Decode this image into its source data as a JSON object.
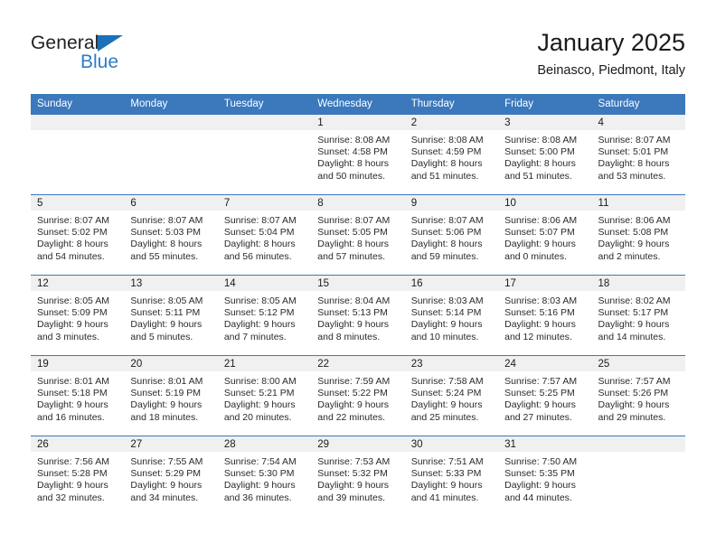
{
  "brand": {
    "name_part1": "General",
    "name_part2": "Blue",
    "triangle_icon": "triangle-icon",
    "accent_color": "#2e7dc4",
    "header_blue": "#3b78bc"
  },
  "header": {
    "title": "January 2025",
    "subtitle": "Beinasco, Piedmont, Italy"
  },
  "weekday_headers": [
    "Sunday",
    "Monday",
    "Tuesday",
    "Wednesday",
    "Thursday",
    "Friday",
    "Saturday"
  ],
  "labels": {
    "sunrise_prefix": "Sunrise:",
    "sunset_prefix": "Sunset:",
    "daylight_prefix": "Daylight:"
  },
  "weeks": [
    [
      {
        "day": "",
        "empty": true
      },
      {
        "day": "",
        "empty": true
      },
      {
        "day": "",
        "empty": true
      },
      {
        "day": "1",
        "sunrise": "Sunrise: 8:08 AM",
        "sunset": "Sunset: 4:58 PM",
        "daylight_line1": "Daylight: 8 hours",
        "daylight_line2": "and 50 minutes."
      },
      {
        "day": "2",
        "sunrise": "Sunrise: 8:08 AM",
        "sunset": "Sunset: 4:59 PM",
        "daylight_line1": "Daylight: 8 hours",
        "daylight_line2": "and 51 minutes."
      },
      {
        "day": "3",
        "sunrise": "Sunrise: 8:08 AM",
        "sunset": "Sunset: 5:00 PM",
        "daylight_line1": "Daylight: 8 hours",
        "daylight_line2": "and 51 minutes."
      },
      {
        "day": "4",
        "sunrise": "Sunrise: 8:07 AM",
        "sunset": "Sunset: 5:01 PM",
        "daylight_line1": "Daylight: 8 hours",
        "daylight_line2": "and 53 minutes."
      }
    ],
    [
      {
        "day": "5",
        "sunrise": "Sunrise: 8:07 AM",
        "sunset": "Sunset: 5:02 PM",
        "daylight_line1": "Daylight: 8 hours",
        "daylight_line2": "and 54 minutes."
      },
      {
        "day": "6",
        "sunrise": "Sunrise: 8:07 AM",
        "sunset": "Sunset: 5:03 PM",
        "daylight_line1": "Daylight: 8 hours",
        "daylight_line2": "and 55 minutes."
      },
      {
        "day": "7",
        "sunrise": "Sunrise: 8:07 AM",
        "sunset": "Sunset: 5:04 PM",
        "daylight_line1": "Daylight: 8 hours",
        "daylight_line2": "and 56 minutes."
      },
      {
        "day": "8",
        "sunrise": "Sunrise: 8:07 AM",
        "sunset": "Sunset: 5:05 PM",
        "daylight_line1": "Daylight: 8 hours",
        "daylight_line2": "and 57 minutes."
      },
      {
        "day": "9",
        "sunrise": "Sunrise: 8:07 AM",
        "sunset": "Sunset: 5:06 PM",
        "daylight_line1": "Daylight: 8 hours",
        "daylight_line2": "and 59 minutes."
      },
      {
        "day": "10",
        "sunrise": "Sunrise: 8:06 AM",
        "sunset": "Sunset: 5:07 PM",
        "daylight_line1": "Daylight: 9 hours",
        "daylight_line2": "and 0 minutes."
      },
      {
        "day": "11",
        "sunrise": "Sunrise: 8:06 AM",
        "sunset": "Sunset: 5:08 PM",
        "daylight_line1": "Daylight: 9 hours",
        "daylight_line2": "and 2 minutes."
      }
    ],
    [
      {
        "day": "12",
        "sunrise": "Sunrise: 8:05 AM",
        "sunset": "Sunset: 5:09 PM",
        "daylight_line1": "Daylight: 9 hours",
        "daylight_line2": "and 3 minutes."
      },
      {
        "day": "13",
        "sunrise": "Sunrise: 8:05 AM",
        "sunset": "Sunset: 5:11 PM",
        "daylight_line1": "Daylight: 9 hours",
        "daylight_line2": "and 5 minutes."
      },
      {
        "day": "14",
        "sunrise": "Sunrise: 8:05 AM",
        "sunset": "Sunset: 5:12 PM",
        "daylight_line1": "Daylight: 9 hours",
        "daylight_line2": "and 7 minutes."
      },
      {
        "day": "15",
        "sunrise": "Sunrise: 8:04 AM",
        "sunset": "Sunset: 5:13 PM",
        "daylight_line1": "Daylight: 9 hours",
        "daylight_line2": "and 8 minutes."
      },
      {
        "day": "16",
        "sunrise": "Sunrise: 8:03 AM",
        "sunset": "Sunset: 5:14 PM",
        "daylight_line1": "Daylight: 9 hours",
        "daylight_line2": "and 10 minutes."
      },
      {
        "day": "17",
        "sunrise": "Sunrise: 8:03 AM",
        "sunset": "Sunset: 5:16 PM",
        "daylight_line1": "Daylight: 9 hours",
        "daylight_line2": "and 12 minutes."
      },
      {
        "day": "18",
        "sunrise": "Sunrise: 8:02 AM",
        "sunset": "Sunset: 5:17 PM",
        "daylight_line1": "Daylight: 9 hours",
        "daylight_line2": "and 14 minutes."
      }
    ],
    [
      {
        "day": "19",
        "sunrise": "Sunrise: 8:01 AM",
        "sunset": "Sunset: 5:18 PM",
        "daylight_line1": "Daylight: 9 hours",
        "daylight_line2": "and 16 minutes."
      },
      {
        "day": "20",
        "sunrise": "Sunrise: 8:01 AM",
        "sunset": "Sunset: 5:19 PM",
        "daylight_line1": "Daylight: 9 hours",
        "daylight_line2": "and 18 minutes."
      },
      {
        "day": "21",
        "sunrise": "Sunrise: 8:00 AM",
        "sunset": "Sunset: 5:21 PM",
        "daylight_line1": "Daylight: 9 hours",
        "daylight_line2": "and 20 minutes."
      },
      {
        "day": "22",
        "sunrise": "Sunrise: 7:59 AM",
        "sunset": "Sunset: 5:22 PM",
        "daylight_line1": "Daylight: 9 hours",
        "daylight_line2": "and 22 minutes."
      },
      {
        "day": "23",
        "sunrise": "Sunrise: 7:58 AM",
        "sunset": "Sunset: 5:24 PM",
        "daylight_line1": "Daylight: 9 hours",
        "daylight_line2": "and 25 minutes."
      },
      {
        "day": "24",
        "sunrise": "Sunrise: 7:57 AM",
        "sunset": "Sunset: 5:25 PM",
        "daylight_line1": "Daylight: 9 hours",
        "daylight_line2": "and 27 minutes."
      },
      {
        "day": "25",
        "sunrise": "Sunrise: 7:57 AM",
        "sunset": "Sunset: 5:26 PM",
        "daylight_line1": "Daylight: 9 hours",
        "daylight_line2": "and 29 minutes."
      }
    ],
    [
      {
        "day": "26",
        "sunrise": "Sunrise: 7:56 AM",
        "sunset": "Sunset: 5:28 PM",
        "daylight_line1": "Daylight: 9 hours",
        "daylight_line2": "and 32 minutes."
      },
      {
        "day": "27",
        "sunrise": "Sunrise: 7:55 AM",
        "sunset": "Sunset: 5:29 PM",
        "daylight_line1": "Daylight: 9 hours",
        "daylight_line2": "and 34 minutes."
      },
      {
        "day": "28",
        "sunrise": "Sunrise: 7:54 AM",
        "sunset": "Sunset: 5:30 PM",
        "daylight_line1": "Daylight: 9 hours",
        "daylight_line2": "and 36 minutes."
      },
      {
        "day": "29",
        "sunrise": "Sunrise: 7:53 AM",
        "sunset": "Sunset: 5:32 PM",
        "daylight_line1": "Daylight: 9 hours",
        "daylight_line2": "and 39 minutes."
      },
      {
        "day": "30",
        "sunrise": "Sunrise: 7:51 AM",
        "sunset": "Sunset: 5:33 PM",
        "daylight_line1": "Daylight: 9 hours",
        "daylight_line2": "and 41 minutes."
      },
      {
        "day": "31",
        "sunrise": "Sunrise: 7:50 AM",
        "sunset": "Sunset: 5:35 PM",
        "daylight_line1": "Daylight: 9 hours",
        "daylight_line2": "and 44 minutes."
      },
      {
        "day": "",
        "empty": true
      }
    ]
  ]
}
